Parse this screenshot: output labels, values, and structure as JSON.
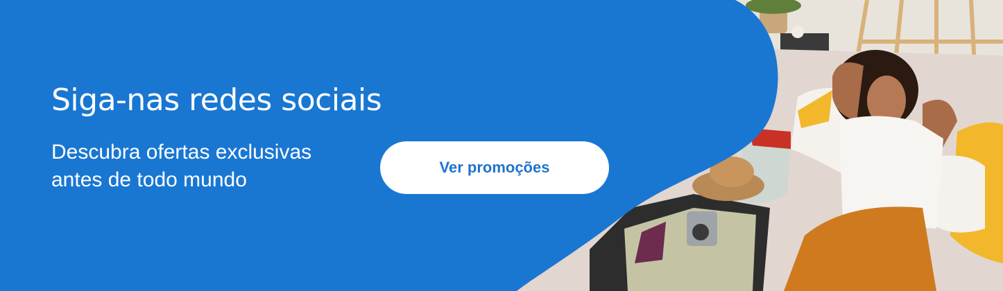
{
  "banner": {
    "title": "Siga-nas redes sociais",
    "subtitle": "Descubra ofertas exclusivas antes de todo mundo",
    "cta_label": "Ver promoções",
    "photo_alt": "woman-relaxing-on-bed-next-to-open-suitcase"
  },
  "colors": {
    "panel_blue": "#1977d2",
    "cta_background": "#ffffff",
    "cta_text": "#1f74cc",
    "text": "#ffffff"
  }
}
